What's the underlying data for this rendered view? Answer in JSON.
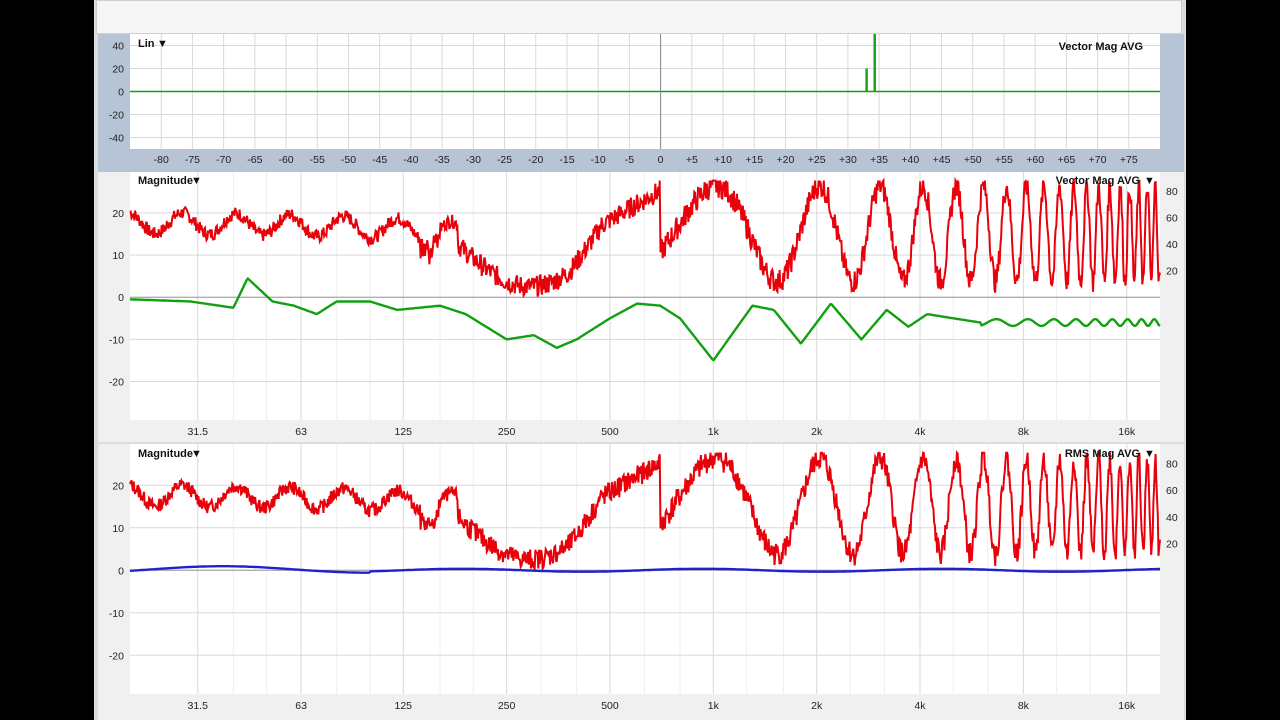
{
  "colors": {
    "magnitude_red": "#e8000b",
    "phase_green": "#10a010",
    "coherence_blue": "#2020d0",
    "impulse_green": "#1aa31a",
    "frame": "#b7c4d6"
  },
  "panels": {
    "impulse": {
      "scale_label": "Lin",
      "mode_label": "Vector Mag AVG"
    },
    "transfer1": {
      "scale_label": "Magnitude",
      "mode_label": "Vector Mag AVG"
    },
    "transfer2": {
      "scale_label": "Magnitude",
      "mode_label": "RMS Mag AVG"
    }
  },
  "chart_data": [
    {
      "type": "line",
      "name": "impulse-response",
      "xlabel": "",
      "ylabel": "",
      "xlim": [
        -85,
        80
      ],
      "ylim": [
        -50,
        50
      ],
      "x_ticks": [
        "-80",
        "-75",
        "-70",
        "-65",
        "-60",
        "-55",
        "-50",
        "-45",
        "-40",
        "-35",
        "-30",
        "-25",
        "-20",
        "-15",
        "-10",
        "-5",
        "0",
        "+5",
        "+10",
        "+15",
        "+20",
        "+25",
        "+30",
        "+35",
        "+40",
        "+45",
        "+50",
        "+55",
        "+60",
        "+65",
        "+70",
        "+75"
      ],
      "y_ticks": [
        40,
        20,
        0,
        -20,
        -40
      ],
      "spikes": [
        {
          "x": 33,
          "y": 20
        },
        {
          "x": 34.3,
          "y": 50
        }
      ]
    },
    {
      "type": "line",
      "name": "transfer-function-vector",
      "x_scale": "log",
      "xlim": [
        20,
        20000
      ],
      "x_ticks": [
        "31.5",
        "63",
        "125",
        "250",
        "500",
        "1k",
        "2k",
        "4k",
        "8k",
        "16k"
      ],
      "y_left_ticks": [
        20,
        10,
        0,
        -10,
        -20
      ],
      "y_right_ticks": [
        80,
        60,
        40,
        20
      ],
      "series": [
        {
          "color_key": "magnitude_red",
          "axis": "right",
          "values": "coherence trace 0-88, comb filtering ripple increasing with frequency"
        },
        {
          "color_key": "phase_green",
          "axis": "left",
          "points_hz_db": [
            [
              20,
              -0.5
            ],
            [
              30,
              -1
            ],
            [
              40,
              -2.5
            ],
            [
              44,
              4.5
            ],
            [
              52,
              -1
            ],
            [
              60,
              -2
            ],
            [
              70,
              -4
            ],
            [
              80,
              -1
            ],
            [
              100,
              -1
            ],
            [
              120,
              -3
            ],
            [
              160,
              -2
            ],
            [
              190,
              -4
            ],
            [
              250,
              -10
            ],
            [
              300,
              -9
            ],
            [
              350,
              -12
            ],
            [
              400,
              -10
            ],
            [
              500,
              -5
            ],
            [
              600,
              -1.5
            ],
            [
              700,
              -2
            ],
            [
              800,
              -5
            ],
            [
              1000,
              -15
            ],
            [
              1300,
              -2
            ],
            [
              1500,
              -3
            ],
            [
              1800,
              -11
            ],
            [
              2200,
              -1.5
            ],
            [
              2700,
              -10
            ],
            [
              3200,
              -3
            ],
            [
              3700,
              -7
            ],
            [
              4200,
              -4
            ],
            [
              5000,
              -5
            ],
            [
              6000,
              -6
            ],
            [
              20000,
              -6
            ]
          ]
        }
      ]
    },
    {
      "type": "line",
      "name": "transfer-function-rms",
      "x_scale": "log",
      "xlim": [
        20,
        20000
      ],
      "x_ticks": [
        "31.5",
        "63",
        "125",
        "250",
        "500",
        "1k",
        "2k",
        "4k",
        "8k",
        "16k"
      ],
      "y_left_ticks": [
        20,
        10,
        0,
        -10,
        -20
      ],
      "y_right_ticks": [
        80,
        60,
        40,
        20
      ],
      "series": [
        {
          "color_key": "magnitude_red",
          "axis": "right",
          "values": "coherence trace 0-88, comb filtering ripple increasing with frequency"
        },
        {
          "color_key": "coherence_blue",
          "axis": "left",
          "values": "flat near 0 dB (±0.5)"
        }
      ]
    }
  ]
}
